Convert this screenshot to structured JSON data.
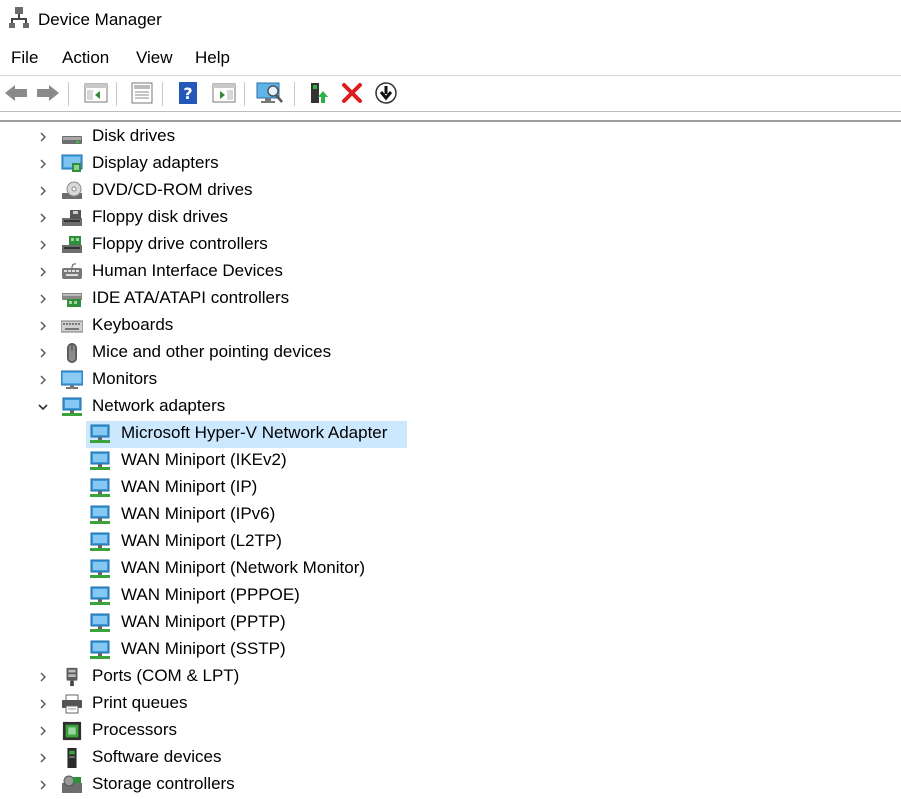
{
  "window": {
    "title": "Device Manager"
  },
  "menu": [
    "File",
    "Action",
    "View",
    "Help"
  ],
  "toolbar": {
    "buttons": [
      "back-icon",
      "forward-icon",
      "show-hide-console-tree-icon",
      "properties-icon",
      "help-icon",
      "show-hide-action-pane-icon",
      "scan-hardware-icon",
      "update-driver-icon",
      "uninstall-icon",
      "disable-device-icon"
    ]
  },
  "tree": {
    "categories_before": [
      {
        "label": "Disk drives",
        "icon": "disk-drive-icon"
      },
      {
        "label": "Display adapters",
        "icon": "display-adapter-icon"
      },
      {
        "label": "DVD/CD-ROM drives",
        "icon": "dvd-drive-icon"
      },
      {
        "label": "Floppy disk drives",
        "icon": "floppy-disk-icon"
      },
      {
        "label": "Floppy drive controllers",
        "icon": "floppy-controller-icon"
      },
      {
        "label": "Human Interface Devices",
        "icon": "hid-icon"
      },
      {
        "label": "IDE ATA/ATAPI controllers",
        "icon": "ide-controller-icon"
      },
      {
        "label": "Keyboards",
        "icon": "keyboard-icon"
      },
      {
        "label": "Mice and other pointing devices",
        "icon": "mouse-icon"
      },
      {
        "label": "Monitors",
        "icon": "monitor-icon"
      }
    ],
    "expanded": {
      "label": "Network adapters",
      "icon": "network-adapter-icon",
      "children": [
        "Microsoft Hyper-V Network Adapter",
        "WAN Miniport (IKEv2)",
        "WAN Miniport (IP)",
        "WAN Miniport (IPv6)",
        "WAN Miniport (L2TP)",
        "WAN Miniport (Network Monitor)",
        "WAN Miniport (PPPOE)",
        "WAN Miniport (PPTP)",
        "WAN Miniport (SSTP)"
      ],
      "selected_child": "Microsoft Hyper-V Network Adapter"
    },
    "categories_after": [
      {
        "label": "Ports (COM & LPT)",
        "icon": "port-icon"
      },
      {
        "label": "Print queues",
        "icon": "printer-icon"
      },
      {
        "label": "Processors",
        "icon": "processor-icon"
      },
      {
        "label": "Software devices",
        "icon": "software-device-icon"
      },
      {
        "label": "Storage controllers",
        "icon": "storage-controller-icon"
      }
    ]
  },
  "colors": {
    "selection": "#cce8ff",
    "network_blue": "#1e90d8",
    "network_green": "#3aa33a"
  }
}
